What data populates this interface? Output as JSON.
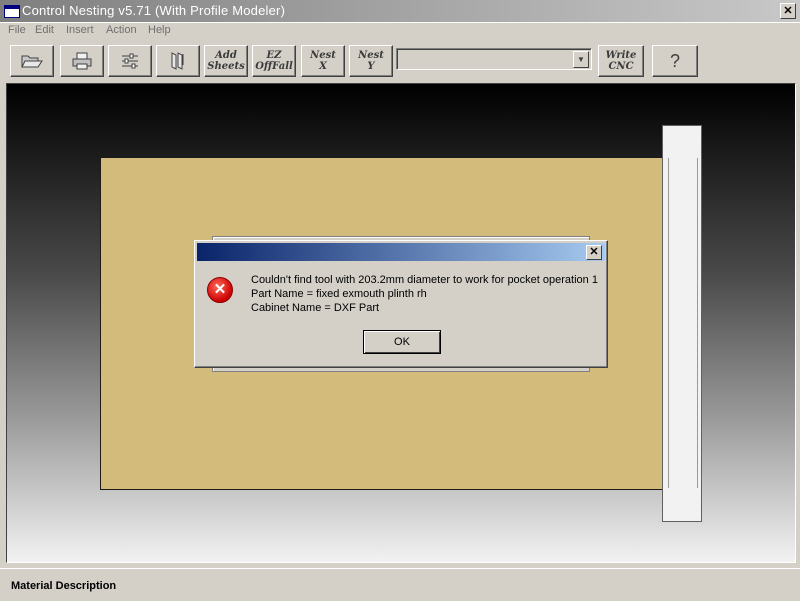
{
  "window": {
    "title": "Control Nesting v5.71 (With Profile Modeler)",
    "close": "✕"
  },
  "menu": [
    "File",
    "Edit",
    "Insert",
    "Action",
    "Help"
  ],
  "toolbar": {
    "open_icon": "folder-open-icon",
    "print_icon": "printer-icon",
    "settings_icon": "settings-sliders-icon",
    "parts_icon": "parts-icon",
    "add_sheets": "Add\nSheets",
    "ez_offfall": "EZ\nOffFall",
    "nest_x": "Nest\nX",
    "nest_y": "Nest\nY",
    "combo_value": "",
    "write_cnc": "Write\nCNC",
    "help": "?"
  },
  "dialog": {
    "title": "",
    "close": "✕",
    "icon": "error-icon",
    "message_line1": "Couldn't find tool with 203.2mm diameter to work for pocket operation 1",
    "message_line2": "Part Name = fixed exmouth plinth rh",
    "message_line3": "Cabinet Name = DXF Part",
    "ok": "OK"
  },
  "status": {
    "material_label": "Material Description"
  },
  "colors": {
    "sheet": "#d3bb7c",
    "dialog_title_start": "#0a246a",
    "dialog_title_end": "#a6caf0"
  }
}
